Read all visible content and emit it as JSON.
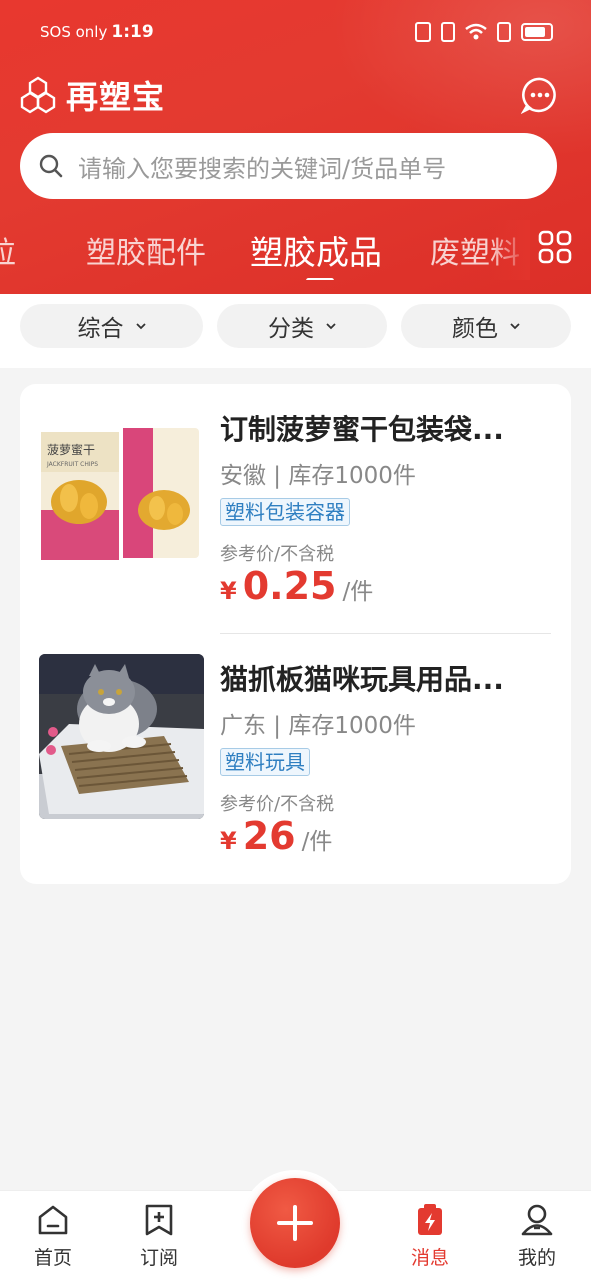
{
  "status_bar": {
    "carrier": "SOS only",
    "time": "1:19"
  },
  "app": {
    "brand_name": "再塑宝"
  },
  "search": {
    "placeholder": "请输入您要搜索的关键词/货品单号"
  },
  "tabs": [
    {
      "label": "粒"
    },
    {
      "label": "塑胶配件"
    },
    {
      "label": "塑胶成品",
      "active": true
    },
    {
      "label": "废塑料"
    }
  ],
  "filters": [
    {
      "label": "综合"
    },
    {
      "label": "分类"
    },
    {
      "label": "颜色"
    }
  ],
  "products": [
    {
      "title": "订制菠萝蜜干包装袋...",
      "meta": "安徽 | 库存1000件",
      "tag": "塑料包装容器",
      "price_note": "参考价/不含税",
      "currency": "¥",
      "price": "0.25",
      "unit": "/件",
      "image_text": "菠萝蜜干",
      "image_subtext": "JACKFRUIT CHIPS"
    },
    {
      "title": "猫抓板猫咪玩具用品...",
      "meta": "广东 | 库存1000件",
      "tag": "塑料玩具",
      "price_note": "参考价/不含税",
      "currency": "¥",
      "price": "26",
      "unit": "/件"
    }
  ],
  "bottom_nav": [
    {
      "label": "首页",
      "icon": "home-icon"
    },
    {
      "label": "订阅",
      "icon": "bookmark-plus-icon"
    },
    {
      "label": "消息",
      "icon": "clipboard-bolt-icon",
      "active": true
    },
    {
      "label": "我的",
      "icon": "user-icon"
    }
  ],
  "colors": {
    "brand_red": "#e33a30",
    "tag_blue": "#2f7fc1"
  }
}
